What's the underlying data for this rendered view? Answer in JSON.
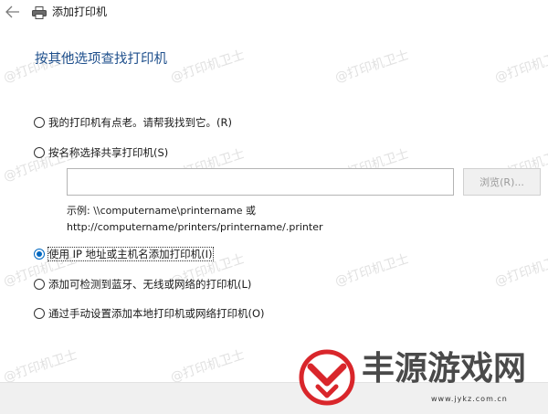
{
  "window": {
    "title": "添加打印机"
  },
  "heading": "按其他选项查找打印机",
  "options": [
    {
      "label": "我的打印机有点老。请帮我找到它。(R)",
      "selected": false
    },
    {
      "label": "按名称选择共享打印机(S)",
      "selected": false
    },
    {
      "label": "使用 IP 地址或主机名添加打印机(I)",
      "selected": true
    },
    {
      "label": "添加可检测到蓝牙、无线或网络的打印机(L)",
      "selected": false
    },
    {
      "label": "通过手动设置添加本地打印机或网络打印机(O)",
      "selected": false
    }
  ],
  "shared_printer": {
    "input_value": "",
    "browse_label": "浏览(R)...",
    "example_line1": "示例: \\\\computername\\printername 或",
    "example_line2": "http://computername/printers/printername/.printer"
  },
  "watermark": {
    "text": "@打印机卫士"
  },
  "branding": {
    "site_name": "丰源游戏网",
    "site_url": "www.jykz.com.cn"
  },
  "colors": {
    "heading": "#1e4f8c",
    "accent": "#0067c0",
    "logo_red": "#d9262b"
  }
}
